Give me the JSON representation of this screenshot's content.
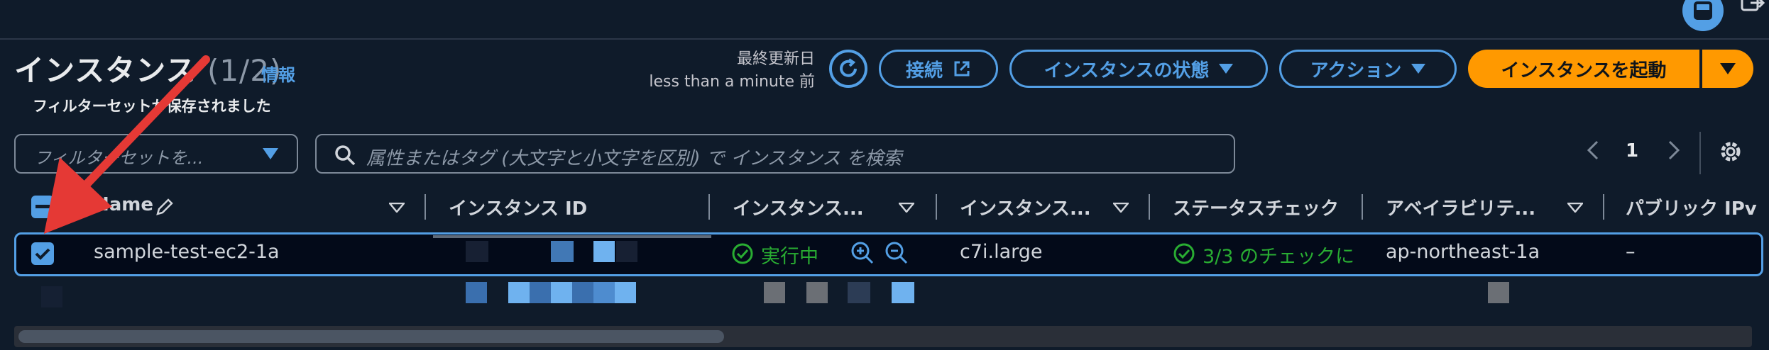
{
  "header": {
    "title": "インスタンス",
    "count": "(1/2)",
    "info_link": "情報",
    "last_updated_label": "最終更新日",
    "last_updated_value": "less than a minute 前",
    "buttons": {
      "connect": "接続",
      "instance_state": "インスタンスの状態",
      "actions": "アクション",
      "launch": "インスタンスを起動"
    }
  },
  "filters": {
    "saved_set_label": "フィルターセットが保存されました",
    "saved_set_placeholder": "フィルターセットを...",
    "search_placeholder": "属性またはタグ (大文字と小文字を区別) で インスタンス を検索"
  },
  "pagination": {
    "current_page": "1"
  },
  "table": {
    "columns": [
      "Name",
      "インスタンス ID",
      "インスタンス...",
      "インスタンス...",
      "ステータスチェック",
      "アベイラビリテ...",
      "パブリック IPv"
    ],
    "rows": [
      {
        "name": "sample-test-ec2-1a",
        "state": "実行中",
        "type": "c7i.large",
        "status_check": "3/3 のチェックに",
        "az": "ap-northeast-1a",
        "public_ip": "–"
      }
    ]
  },
  "colors": {
    "accent": "#539fe5",
    "primary": "#ff9900",
    "success": "#29ad32",
    "annotation_arrow": "#e53935"
  }
}
